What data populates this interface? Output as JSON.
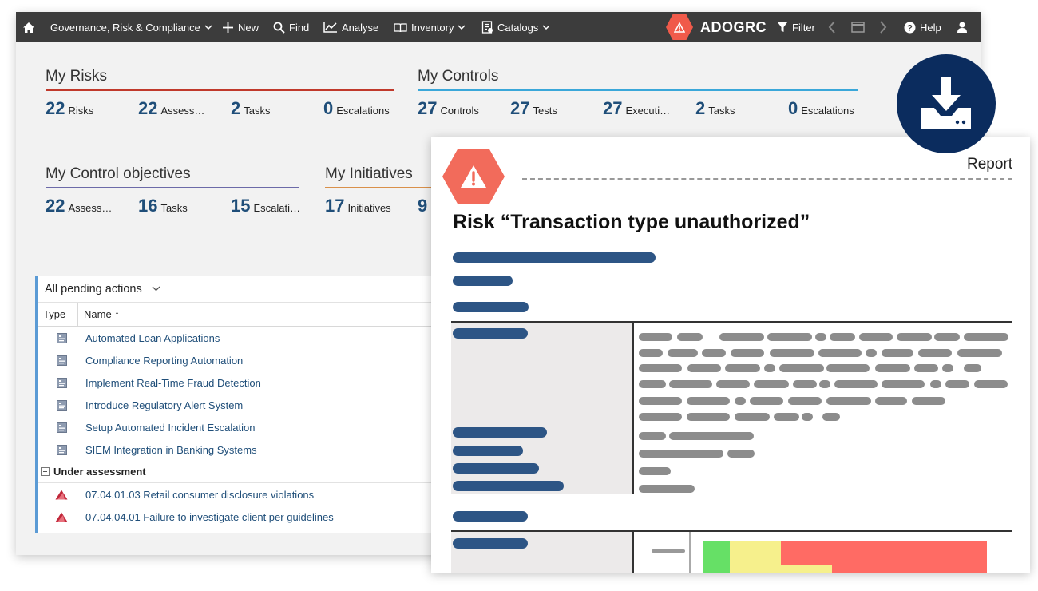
{
  "topbar": {
    "home_icon": "home-icon",
    "module_menu": "Governance, Risk & Compliance",
    "new_label": "New",
    "find_label": "Find",
    "analyse_label": "Analyse",
    "inventory_label": "Inventory",
    "catalogs_label": "Catalogs",
    "brand": "ADOGRC",
    "filter_label": "Filter",
    "help_label": "Help"
  },
  "widgets": {
    "my_risks": {
      "title": "My Risks",
      "color": "#c0392b",
      "kpis": [
        {
          "value": "22",
          "label": "Risks"
        },
        {
          "value": "22",
          "label": "Assess…"
        },
        {
          "value": "2",
          "label": "Tasks"
        },
        {
          "value": "0",
          "label": "Escalations"
        }
      ]
    },
    "my_controls": {
      "title": "My Controls",
      "color": "#3aa7d9",
      "kpis": [
        {
          "value": "27",
          "label": "Controls"
        },
        {
          "value": "27",
          "label": "Tests"
        },
        {
          "value": "27",
          "label": "Executi…"
        },
        {
          "value": "2",
          "label": "Tasks"
        },
        {
          "value": "0",
          "label": "Escalations"
        }
      ]
    },
    "my_control_objectives": {
      "title": "My Control objectives",
      "color": "#6c6aa8",
      "kpis": [
        {
          "value": "22",
          "label": "Assess…"
        },
        {
          "value": "16",
          "label": "Tasks"
        },
        {
          "value": "15",
          "label": "Escalati…"
        }
      ]
    },
    "my_initiatives": {
      "title": "My Initiatives",
      "color": "#d9904a",
      "kpis": [
        {
          "value": "17",
          "label": "Initiatives"
        },
        {
          "value": "9",
          "label": ""
        }
      ]
    }
  },
  "pending": {
    "filter_label": "All pending actions",
    "col_type": "Type",
    "col_name": "Name ↑",
    "items": [
      "Automated Loan Applications",
      "Compliance Reporting Automation",
      "Implement Real-Time Fraud Detection",
      "Introduce Regulatory Alert System",
      "Setup Automated Incident Escalation",
      "SIEM Integration in Banking Systems"
    ],
    "group_label": "Under assessment",
    "group_items": [
      "07.04.01.03 Retail consumer disclosure violations",
      "07.04.04.01 Failure to investigate client per guidelines"
    ]
  },
  "report": {
    "label": "Report",
    "title": "Risk “Transaction type unauthorized”",
    "heatmap_colors": [
      "#66e066",
      "#f6f08c",
      "#ff6b64"
    ]
  },
  "download": {
    "icon": "download-icon"
  }
}
